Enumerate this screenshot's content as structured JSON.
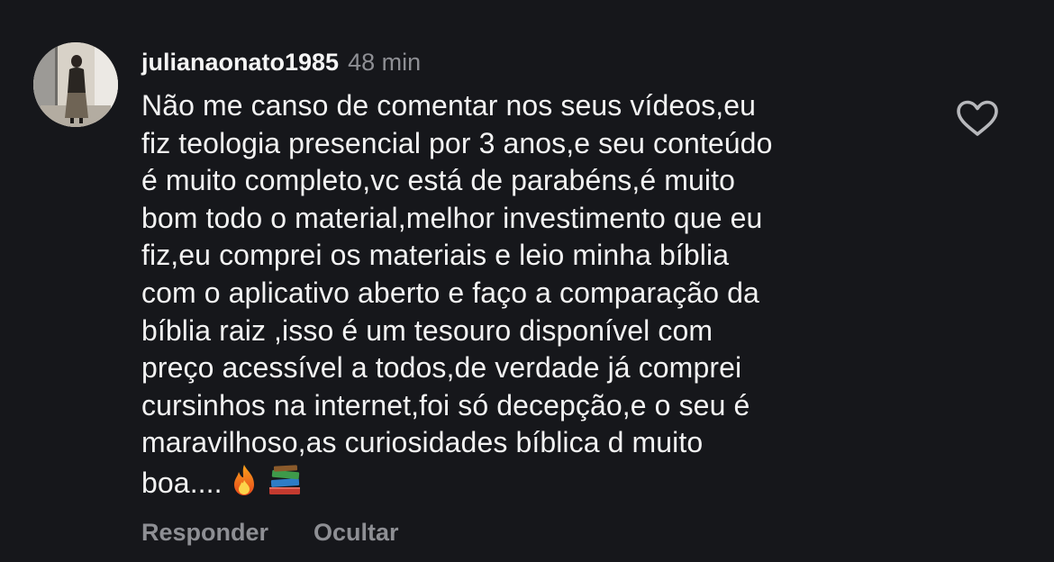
{
  "comment": {
    "username": "julianaonato1985",
    "time": "48 min",
    "text": "Não me canso de comentar nos seus vídeos,eu\nfiz teologia presencial por 3 anos,e seu conteúdo\né muito completo,vc está de parabéns,é muito\nbom todo o material,melhor investimento que eu\nfiz,eu comprei os materiais e leio minha bíblia\ncom o aplicativo aberto e faço a comparação da\nbíblia raiz ,isso é um tesouro disponível com\npreço acessível a todos,de verdade já comprei\ncursinhos na internet,foi só decepção,e o seu é\nmaravilhoso,as curiosidades bíblica d muito\nboa....",
    "emojis": [
      "fire-icon",
      "books-icon"
    ]
  },
  "actions": {
    "reply_label": "Responder",
    "hide_label": "Ocultar"
  },
  "colors": {
    "background": "#16171b",
    "text": "#f2f2f2",
    "muted": "#8e8f94"
  },
  "icons": {
    "like": "heart-outline-icon",
    "avatar": "profile-photo"
  }
}
